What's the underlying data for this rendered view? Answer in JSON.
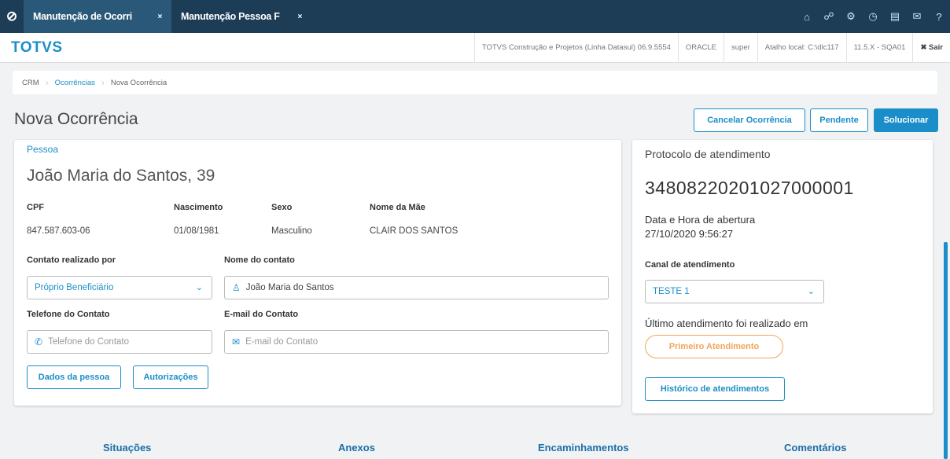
{
  "topbar": {
    "logo_icon": "totvs-logo-icon",
    "tabs": [
      {
        "label": "Manutenção de Ocorri",
        "close": "×"
      },
      {
        "label": "Manutenção Pessoa F",
        "close": "×"
      }
    ],
    "icons": [
      "home-icon",
      "sitemap-icon",
      "gear-icon",
      "clock-icon",
      "document-icon",
      "mail-icon",
      "help-icon"
    ]
  },
  "header": {
    "brand": "TOTVS",
    "company": "TOTVS Construção e Projetos (Linha Datasul) 06.9.5554",
    "database": "ORACLE",
    "user": "super",
    "shortcut": "Atalho local: C:\\dlc117",
    "version": "11.5.X - SQA01",
    "exit": "✖ Sair"
  },
  "breadcrumb": [
    "CRM",
    "Ocorrências",
    "Nova Ocorrência"
  ],
  "page": {
    "title": "Nova Ocorrência",
    "actions": {
      "cancel": "Cancelar Ocorrência",
      "pending": "Pendente",
      "solve": "Solucionar"
    }
  },
  "person": {
    "section_label": "Pessoa",
    "name": "João Maria do Santos, 39",
    "cpf_label": "CPF",
    "cpf": "847.587.603-06",
    "birth_label": "Nascimento",
    "birth": "01/08/1981",
    "sex_label": "Sexo",
    "sex": "Masculino",
    "mother_label": "Nome da Mãe",
    "mother": "CLAIR DOS SANTOS",
    "contact_by_label": "Contato realizado por",
    "contact_by_value": "Próprio Beneficiário",
    "contact_name_label": "Nome do contato",
    "contact_name_value": "João Maria do Santos",
    "phone_label": "Telefone do Contato",
    "phone_placeholder": "Telefone do Contato",
    "email_label": "E-mail do Contato",
    "email_placeholder": "E-mail do Contato",
    "btn_person_data": "Dados da pessoa",
    "btn_authorizations": "Autorizações"
  },
  "service": {
    "protocol_label": "Protocolo de atendimento",
    "protocol": "34808220201027000001",
    "opened_label": "Data e Hora de abertura",
    "opened_value": "27/10/2020 9:56:27",
    "channel_label": "Canal de atendimento",
    "channel_value": "TESTE 1",
    "last_label": "Último atendimento foi realizado em",
    "last_badge": "Primeiro Atendimento",
    "history_button": "Histórico de atendimentos"
  },
  "bottom_tabs": [
    "Situações",
    "Anexos",
    "Encaminhamentos",
    "Comentários"
  ],
  "colors": {
    "topbar": "#1d3d57",
    "accent": "#1b8ec9",
    "badge": "#f0a55a"
  }
}
